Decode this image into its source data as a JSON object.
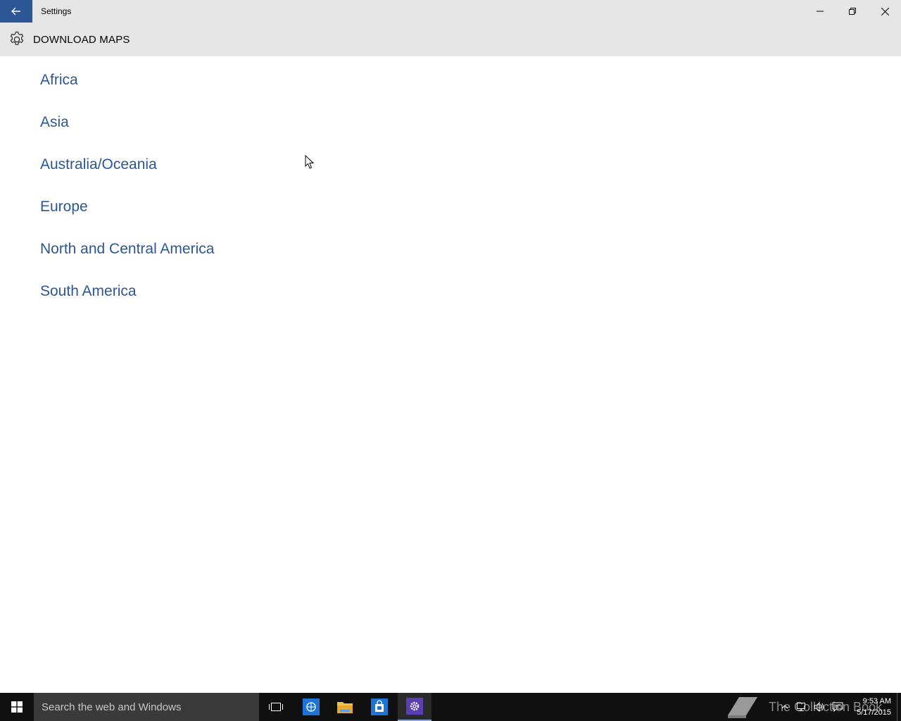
{
  "window": {
    "title": "Settings",
    "controls": {
      "minimize": "minimize-icon",
      "restore": "restore-icon",
      "close": "close-icon"
    }
  },
  "header": {
    "title": "DOWNLOAD MAPS",
    "icon": "gear-icon"
  },
  "regions": [
    {
      "label": "Africa"
    },
    {
      "label": "Asia"
    },
    {
      "label": "Australia/Oceania"
    },
    {
      "label": "Europe"
    },
    {
      "label": "North and Central America"
    },
    {
      "label": "South America"
    }
  ],
  "taskbar": {
    "search_placeholder": "Search the web and Windows",
    "watermark": "The Collection Book",
    "time": "9:53 AM",
    "date": "5/17/2015"
  },
  "colors": {
    "accent": "#2b5797",
    "link": "#2b5797",
    "chrome": "#e6e6e6",
    "taskbar": "#101010"
  }
}
